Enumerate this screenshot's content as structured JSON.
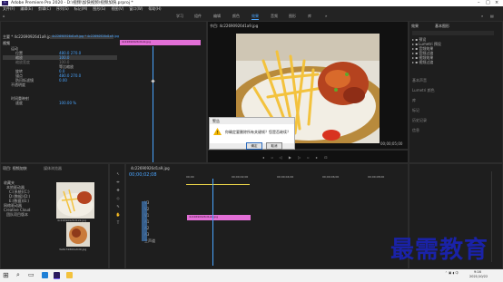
{
  "title": "Adobe Premiere Pro 2020 - D:\\视频\\加快视频\\视频加快.prproj *",
  "menu": [
    "文件(F)",
    "编辑(E)",
    "剪辑(C)",
    "序列(S)",
    "标记(M)",
    "图形(G)",
    "视图(V)",
    "窗口(W)",
    "帮助(H)"
  ],
  "workspaces": [
    "学习",
    "组件",
    "编辑",
    "颜色",
    "效果",
    "音频",
    "图形",
    "库"
  ],
  "active_workspace": "效果",
  "effect_controls": {
    "tab": "主要 * 4c22690926d1a9.jpg",
    "seq_tab": "4c22690926d1a9.jpg * 4c22690926d1a9.jpg",
    "clip_label": "4c22690926d1a9.jpg",
    "section_video": "视频",
    "rows": [
      "运动",
      "位置",
      "缩放",
      "缩放宽度",
      "",
      "旋转",
      "锚点",
      "防闪烁滤镜",
      "不透明度",
      "",
      "",
      "时间重映射",
      "速度",
      "",
      ""
    ],
    "values": [
      "",
      "480.0  270.0",
      "100.0",
      "100.0",
      "等比缩放",
      "0.0",
      "480.0  270.0",
      "0.00",
      "",
      "",
      "",
      "",
      "100.00 %",
      "",
      ""
    ]
  },
  "program_monitor": {
    "tab": "节目: 4c22690926d1a9.jpg",
    "timecode_left": "00;00;02;08",
    "fit": "适合",
    "timecode_right": "00;00;05;00"
  },
  "effects_panel": {
    "tabs": [
      "效果",
      "基本图形"
    ],
    "items": [
      "预设",
      "Lumetri 预设",
      "音频效果",
      "音频过渡",
      "视频效果",
      "视频过渡"
    ],
    "sub": [
      "基本声音",
      "Lumetri 颜色",
      "库",
      "标记",
      "历史记录",
      "信息"
    ]
  },
  "project": {
    "tab": "项目: 视频加快",
    "tab2": "媒体浏览器",
    "tree": [
      "收藏夹",
      "本地驱动器",
      "C:(系统)(C:)",
      "D:(数据)(D:)",
      "E:(数据)(E:)",
      "网络驱动器",
      "Creative Cloud",
      "团队项目版本"
    ],
    "thumb1": "4c22690926d1a9.jpg",
    "thumb2": "3a6131860e6d9.jpg"
  },
  "timeline": {
    "tab": "4c22690926d1a9.jpg",
    "timecode": "00;00;02;08",
    "ruler": [
      "00;00",
      "00;00;02;00",
      "00;00;04;00",
      "00;00;06;00",
      "00;00;08;00"
    ],
    "tracks": [
      "V3",
      "V2",
      "V1",
      "A1",
      "A2",
      "A3",
      "主声道"
    ],
    "clip": "4c22690926d1a9.jpg"
  },
  "dialog": {
    "title": "警告",
    "message": "你确定要删除所有关键帧？您是否继续？",
    "ok": "确定",
    "cancel": "取消"
  },
  "taskbar": {
    "time": "9:16",
    "date": "2021/10/22"
  },
  "watermark": "最需教育",
  "colors": {
    "accent": "#4aa5ff",
    "clip": "#e26fd6",
    "warning": "#f0b400"
  }
}
